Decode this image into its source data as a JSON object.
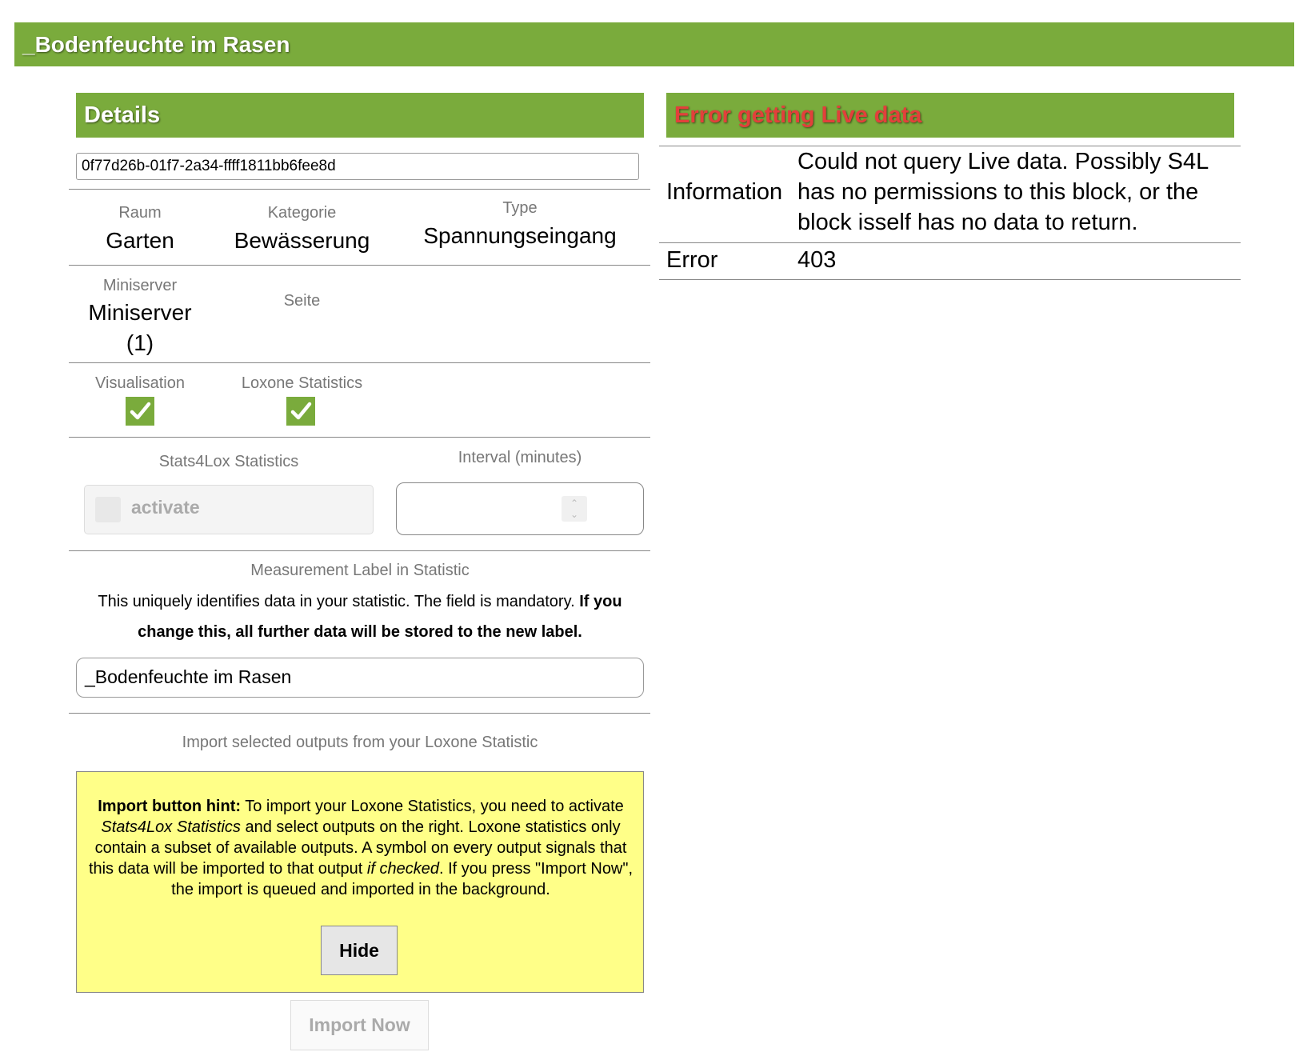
{
  "page_title": "_Bodenfeuchte im Rasen",
  "details": {
    "header": "Details",
    "uuid": "0f77d26b-01f7-2a34-ffff1811bb6fee8d",
    "raum_label": "Raum",
    "raum_value": "Garten",
    "kategorie_label": "Kategorie",
    "kategorie_value": "Bewässerung",
    "type_label": "Type",
    "type_value": "Spannungseingang",
    "miniserver_label": "Miniserver",
    "miniserver_value_line1": "Miniserver",
    "miniserver_value_line2": "(1)",
    "seite_label": "Seite",
    "visualisation_label": "Visualisation",
    "visualisation_checked": true,
    "loxone_statistics_label": "Loxone Statistics",
    "loxone_statistics_checked": true,
    "stats4lox_label": "Stats4Lox Statistics",
    "activate_label": "activate",
    "activate_checked": false,
    "interval_label": "Interval (minutes)",
    "interval_value": "",
    "measurement_label_title": "Measurement Label in Statistic",
    "measurement_desc_normal": "This uniquely identifies data in your statistic. The field is mandatory.",
    "measurement_desc_bold": "If you change this, all further data will be stored to the new label.",
    "measurement_value": "_Bodenfeuchte im Rasen",
    "import_title": "Import selected outputs from your Loxone Statistic",
    "hint": {
      "bold_prefix": "Import button hint:",
      "part1": "To import your Loxone Statistics, you need to activate",
      "italic1": "Stats4Lox Statistics",
      "part2": "and select outputs on the right. Loxone statistics only contain a subset of available outputs. A symbol on every output signals that this data will be imported to that output",
      "italic2": "if checked",
      "part3": ". If you press \"Import Now\", the import is queued and imported in the background."
    },
    "hide_button": "Hide",
    "import_now_button": "Import Now"
  },
  "live": {
    "header": "Error getting Live data",
    "information_label": "Information",
    "information_line1": "Could not query Live data. Possibly S4L",
    "information_line2": "has no permissions to this block, or the",
    "information_line3": "block isself has no data to return.",
    "error_label": "Error",
    "error_value": "403"
  },
  "colors": {
    "header_green": "#7aab3c",
    "error_red": "#e2403b",
    "hint_yellow": "#ffff88"
  }
}
